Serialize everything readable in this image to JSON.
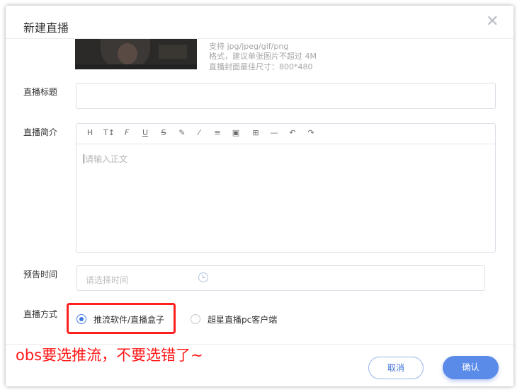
{
  "dialog": {
    "title": "新建直播",
    "close_glyph": "✕"
  },
  "cover": {
    "hints": [
      "支持 jpg/jpeg/gif/png",
      "格式，建议单张图片不超过 4M",
      "直播封面最佳尺寸：800*480"
    ]
  },
  "form": {
    "title_label": "直播标题",
    "title_value": "",
    "intro_label": "直播简介",
    "intro_placeholder": "请输入正文",
    "toolbar": [
      "H",
      "T↕",
      "F",
      "U",
      "S",
      "✎",
      "⁄",
      "≡",
      "▣",
      "⊞",
      "—",
      "↶",
      "↷"
    ],
    "time_label": "预告时间",
    "time_placeholder": "请选择时间",
    "mode_label": "直播方式",
    "mode_options": [
      {
        "label": "推流软件/直播盒子",
        "selected": true
      },
      {
        "label": "超星直播pc客户端",
        "selected": false
      }
    ]
  },
  "annotation": {
    "text": "obs要选推流，不要选错了~",
    "color": "#ff1818"
  },
  "footer": {
    "cancel_label": "取消",
    "ok_label": "确认"
  },
  "colors": {
    "accent": "#5b8be8",
    "highlight_border": "#ff1f1f"
  }
}
